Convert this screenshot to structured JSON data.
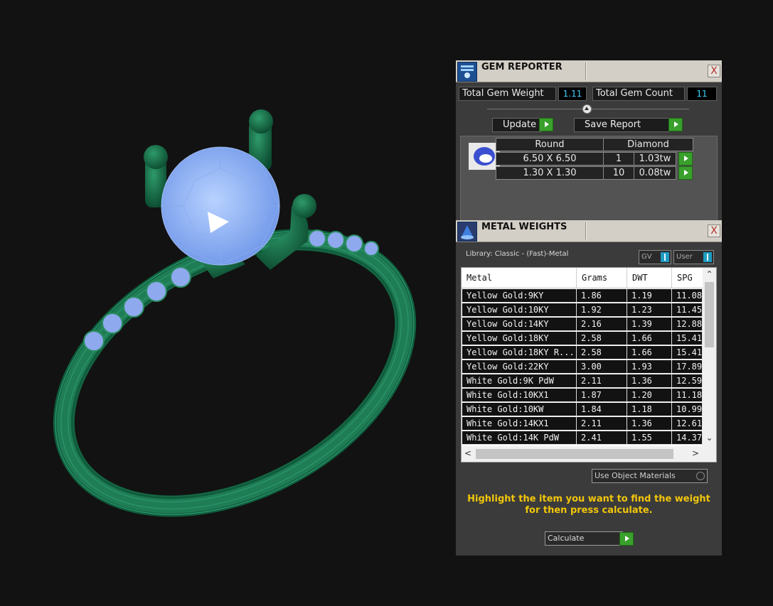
{
  "gem_reporter": {
    "title": "GEM REPORTER",
    "close": "X",
    "total_weight_label": "Total Gem Weight",
    "total_weight_value": "1.11",
    "total_count_label": "Total Gem Count",
    "total_count_value": "11",
    "update_label": "Update",
    "save_report_label": "Save Report",
    "headers": [
      "Round",
      "Diamond"
    ],
    "rows": [
      {
        "size": "6.50 X 6.50",
        "qty": "1",
        "weight": "1.03tw"
      },
      {
        "size": "1.30 X 1.30",
        "qty": "10",
        "weight": "0.08tw"
      }
    ]
  },
  "metal_weights": {
    "title": "METAL WEIGHTS",
    "close": "X",
    "library": "Library: Classic - (Fast)-Metal",
    "toggle_gv": "GV",
    "toggle_user": "User",
    "columns": [
      "Metal",
      "Grams",
      "DWT",
      "SPG"
    ],
    "rows": [
      [
        "Yellow Gold:9KY",
        "1.86",
        "1.19",
        "11.08"
      ],
      [
        "Yellow Gold:10KY",
        "1.92",
        "1.23",
        "11.45"
      ],
      [
        "Yellow Gold:14KY",
        "2.16",
        "1.39",
        "12.88"
      ],
      [
        "Yellow Gold:18KY",
        "2.58",
        "1.66",
        "15.41"
      ],
      [
        "Yellow Gold:18KY R...",
        "2.58",
        "1.66",
        "15.41"
      ],
      [
        "Yellow Gold:22KY",
        "3.00",
        "1.93",
        "17.89"
      ],
      [
        "White Gold:9K PdW",
        "2.11",
        "1.36",
        "12.59"
      ],
      [
        "White Gold:10KX1",
        "1.87",
        "1.20",
        "11.18"
      ],
      [
        "White Gold:10KW",
        "1.84",
        "1.18",
        "10.99"
      ],
      [
        "White Gold:14KX1",
        "2.11",
        "1.36",
        "12.61"
      ],
      [
        "White Gold:14K PdW",
        "2.41",
        "1.55",
        "14.37"
      ]
    ],
    "use_object_materials": "Use Object Materials",
    "hint": "Highlight the item you want to find the weight for then press calculate.",
    "calculate_label": "Calculate"
  }
}
